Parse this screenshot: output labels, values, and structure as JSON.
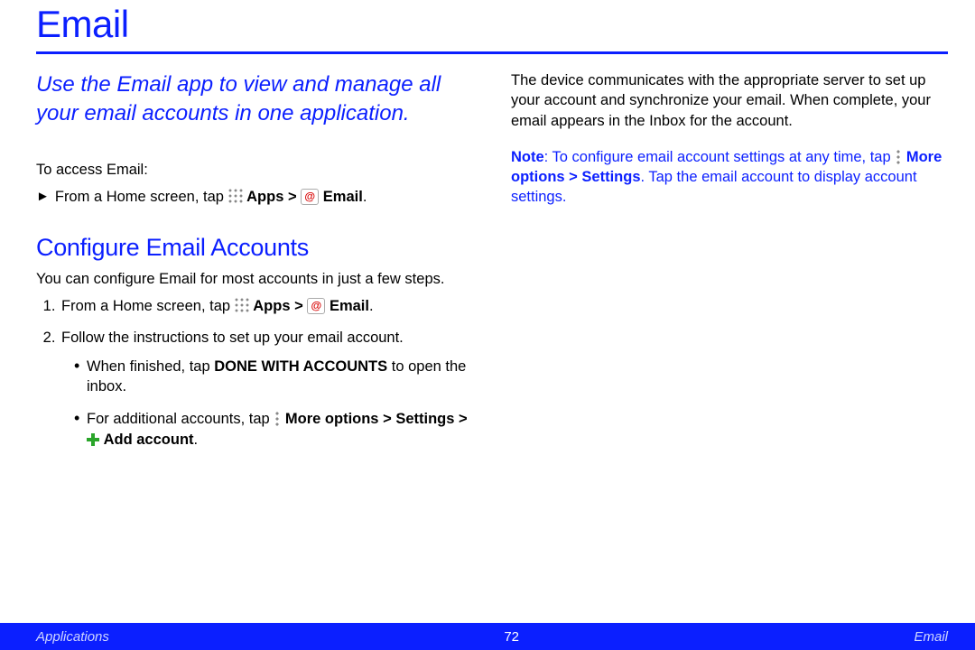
{
  "title": "Email",
  "intro": "Use the Email app to view and manage all your email accounts in one application.",
  "access_label": "To access Email:",
  "access_step_prefix": "From a Home screen, tap",
  "apps_label": "Apps",
  "email_label": "Email",
  "gt": ">",
  "subhead": "Configure Email Accounts",
  "configure_desc": "You can configure Email for most accounts in just a few steps.",
  "step1_prefix": "From a Home screen, tap",
  "step2": "Follow the instructions to set up your email account.",
  "sub_a_prefix": "When finished, tap",
  "sub_a_bold": "DONE WITH ACCOUNTS",
  "sub_a_suffix": "to open the inbox.",
  "sub_b_prefix": "For additional accounts, tap",
  "more_options_label": "More options",
  "settings_label": "Settings",
  "add_account_label": "Add account",
  "period": ".",
  "col2_para": "The device communicates with the appropriate server to set up your account and synchronize your email. When complete, your email appears in the Inbox for the account.",
  "note_label": "Note",
  "note_prefix": ": To configure email account settings at any time, tap",
  "note_suffix": ". Tap the email account to display account settings.",
  "footer": {
    "left": "Applications",
    "center": "72",
    "right": "Email"
  }
}
